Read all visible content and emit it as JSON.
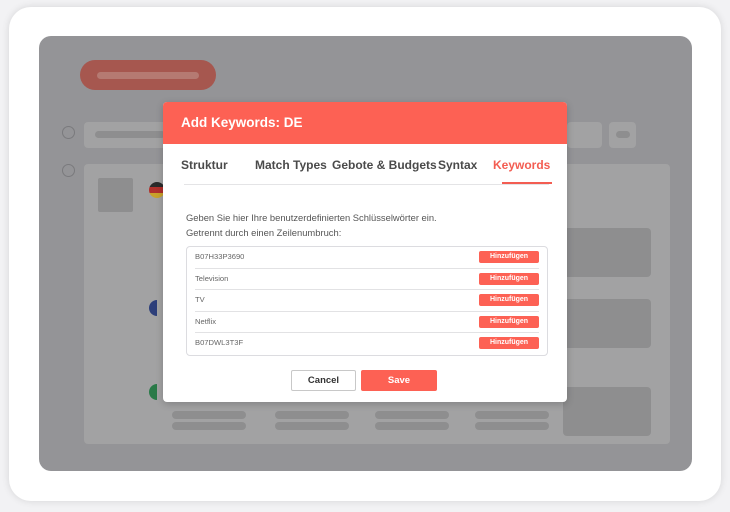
{
  "modal": {
    "title": "Add Keywords: DE",
    "tabs": [
      {
        "label": "Struktur",
        "active": false
      },
      {
        "label": "Match Types",
        "active": false
      },
      {
        "label": "Gebote & Budgets",
        "active": false
      },
      {
        "label": "Syntax",
        "active": false
      },
      {
        "label": "Keywords",
        "active": true
      }
    ],
    "description_line1": "Geben Sie hier Ihre benutzerdefinierten Schlüsselwörter ein.",
    "description_line2": "Getrennt durch einen Zeilenumbruch:",
    "keywords": [
      {
        "text": "B07H33P3690",
        "action": "Hinzufügen"
      },
      {
        "text": "Television",
        "action": "Hinzufügen"
      },
      {
        "text": "TV",
        "action": "Hinzufügen"
      },
      {
        "text": "Netflix",
        "action": "Hinzufügen"
      },
      {
        "text": "B07DWL3T3F",
        "action": "Hinzufügen"
      }
    ],
    "cancel_label": "Cancel",
    "save_label": "Save"
  },
  "colors": {
    "accent": "#fd6154",
    "backdrop": "#949497"
  },
  "background": {
    "flags": [
      "germany-flag-icon",
      "france-flag-icon",
      "italy-flag-icon"
    ]
  }
}
